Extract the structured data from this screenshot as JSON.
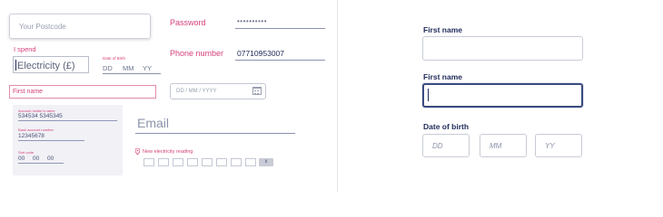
{
  "left": {
    "postcode_placeholder": "Your Postcode",
    "password_label": "Password",
    "password_value": "••••••••••",
    "ispend_label": "I spend",
    "electricity_value": "Electricity (£)",
    "dob_small_label": "Date of Birth",
    "dob_parts": [
      "DD",
      "MM",
      "YY"
    ],
    "phone_label": "Phone number",
    "phone_value": "07710953007",
    "firstname_label": "First name",
    "date_placeholder": "DD / MM / YYYY",
    "bank": {
      "holder_label": "Account holder's name",
      "holder_value": "534534 5345345",
      "account_label": "Bank account number",
      "account_value": "12345678",
      "sortcode_label": "Sort code",
      "sortcode_parts": [
        "00",
        "00",
        "00"
      ]
    },
    "email_label": "Email",
    "new_reading_label": "New electricity reading",
    "reading_button": "x"
  },
  "right": {
    "first_name_label_1": "First name",
    "first_name_label_2": "First name",
    "dob_label": "Date of birth",
    "dob_placeholders": [
      "DD",
      "MM",
      "YY"
    ]
  },
  "colors": {
    "navy": "#1e2a5a",
    "pink": "#d6407a",
    "focus_border": "#3a4c80"
  }
}
